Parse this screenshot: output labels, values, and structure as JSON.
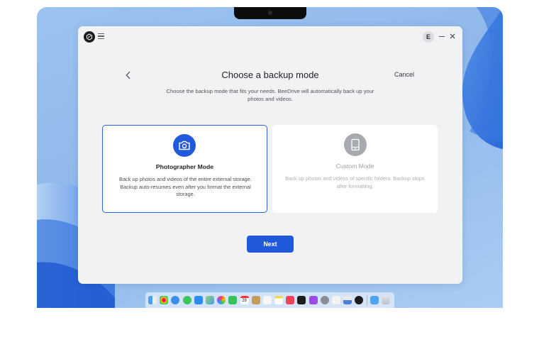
{
  "window": {
    "avatar_initial": "E"
  },
  "page": {
    "title": "Choose a backup mode",
    "cancel_label": "Cancel",
    "description": "Choose the backup mode that fits your needs. BeeDrive will automatically back up your photos and videos."
  },
  "modes": [
    {
      "name": "Photographer Mode",
      "description": "Back up photos and videos of the entire external storage. Backup auto-resumes even after you format the external storage.",
      "selected": true,
      "icon": "camera-icon"
    },
    {
      "name": "Custom Mode",
      "description": "Back up photos and videos of specific folders. Backup stops after formatting.",
      "selected": false,
      "icon": "tablet-icon"
    }
  ],
  "actions": {
    "next_label": "Next"
  },
  "dock": {
    "calendar_day": "28"
  },
  "colors": {
    "accent": "#2059dc",
    "window_bg": "#f1f2f4",
    "disabled_icon": "#a7abb0"
  }
}
